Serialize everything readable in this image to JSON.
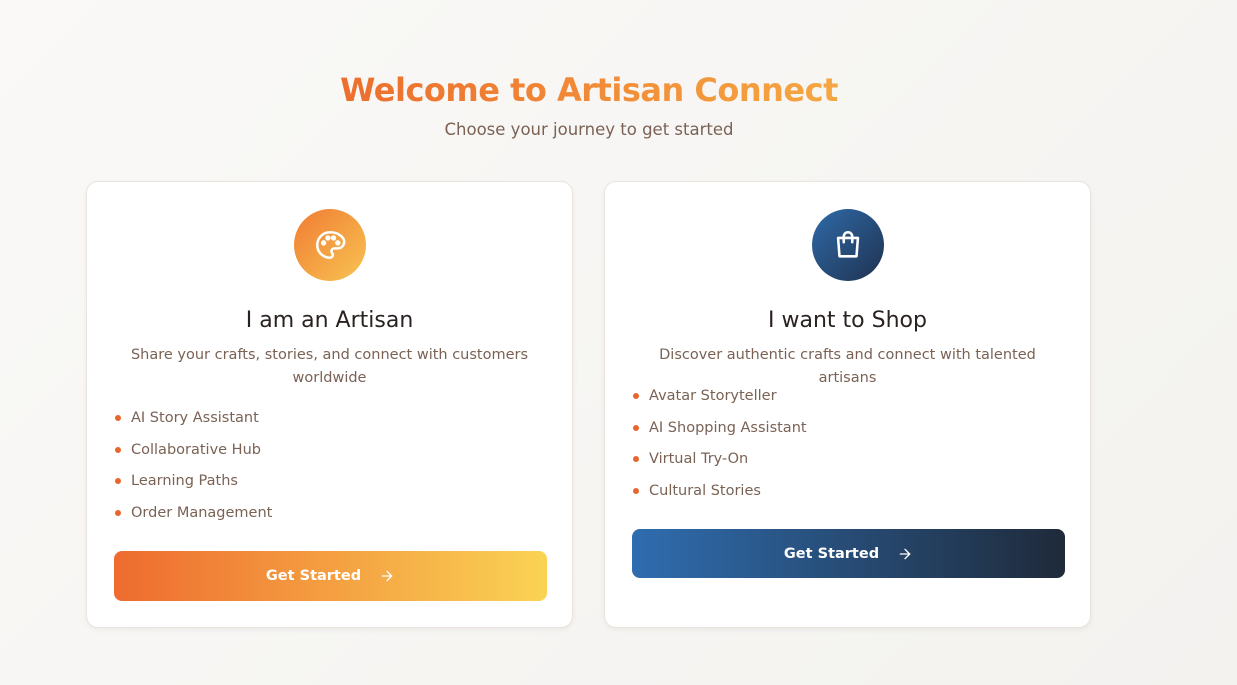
{
  "header": {
    "title": "Welcome to Artisan Connect",
    "subtitle": "Choose your journey to get started"
  },
  "cards": [
    {
      "icon": "palette-icon",
      "title": "I am an Artisan",
      "description": "Share your crafts, stories, and connect with customers worldwide",
      "features": [
        "AI Story Assistant",
        "Collaborative Hub",
        "Learning Paths",
        "Order Management"
      ],
      "cta_label": "Get Started",
      "accent": [
        "#ee6b2f",
        "#fad354"
      ]
    },
    {
      "icon": "shopping-bag-icon",
      "title": "I want to Shop",
      "description": "Discover authentic crafts and connect with talented artisans",
      "features": [
        "Avatar Storyteller",
        "AI Shopping Assistant",
        "Virtual Try-On",
        "Cultural Stories"
      ],
      "cta_label": "Get Started",
      "accent": [
        "#2f6db0",
        "#1f2a3a"
      ]
    }
  ],
  "colors": {
    "bullet": "#e8652e",
    "heading": "#2a2220",
    "muted_text": "#7a6255"
  }
}
